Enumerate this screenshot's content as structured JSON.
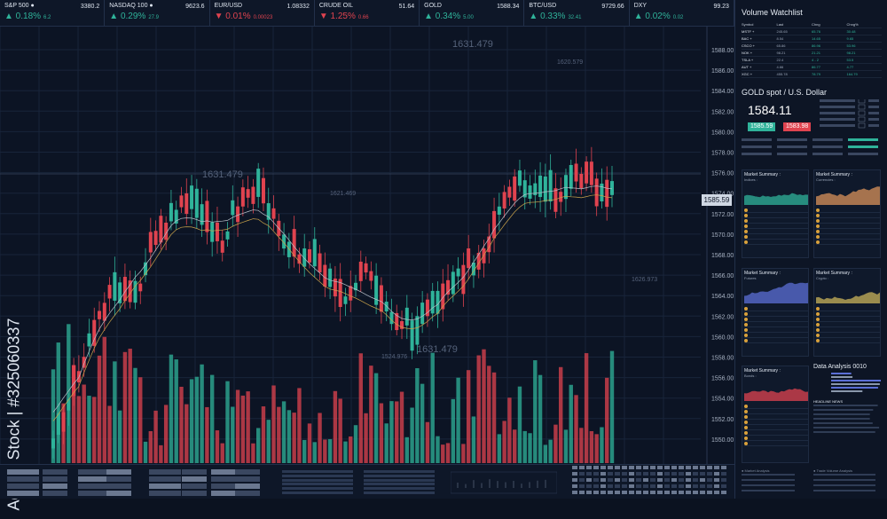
{
  "ticker": [
    {
      "name": "S&P 500 ●",
      "price": "3380.2",
      "change": "0.18%",
      "delta": "6.2",
      "dir": "up"
    },
    {
      "name": "NASDAQ 100 ●",
      "price": "9623.6",
      "change": "0.29%",
      "delta": "27.9",
      "dir": "up"
    },
    {
      "name": "EUR/USD",
      "price": "1.08332",
      "change": "0.01%",
      "delta": "0.00023",
      "dir": "dn"
    },
    {
      "name": "CRUDE OIL",
      "price": "51.64",
      "change": "1.25%",
      "delta": "0.66",
      "dir": "dn"
    },
    {
      "name": "GOLD",
      "price": "1588.34",
      "change": "0.34%",
      "delta": "5.00",
      "dir": "up"
    },
    {
      "name": "BTC/USD",
      "price": "9729.66",
      "change": "0.33%",
      "delta": "32.41",
      "dir": "up"
    },
    {
      "name": "DXY",
      "price": "99.23",
      "change": "0.02%",
      "delta": "0.02",
      "dir": "up"
    }
  ],
  "chart": {
    "price_tag": "1585.59",
    "y_ticks": [
      "1588.00",
      "1586.00",
      "1584.00",
      "1582.00",
      "1580.00",
      "1578.00",
      "1576.00",
      "1574.00",
      "1572.00",
      "1570.00",
      "1568.00",
      "1566.00",
      "1564.00",
      "1562.00",
      "1560.00",
      "1558.00",
      "1556.00",
      "1554.00",
      "1552.00",
      "1550.00"
    ],
    "ghost_labels": [
      "1631.479",
      "1620.579",
      "1631.479",
      "1621.469",
      "1631.479",
      "1524.976",
      "1626.973"
    ],
    "stock_id": "Adobe Stock | #325060337"
  },
  "colors": {
    "up": "#2fb39a",
    "down": "#e0434f",
    "bg": "#0c1424"
  },
  "watchlist": {
    "title": "Volume Watchlist",
    "headers": [
      "Symbol",
      "Last",
      "Chng",
      "Chng%"
    ],
    "rows": [
      [
        "MSTF +",
        "245.65",
        "65.76",
        "30.48"
      ],
      [
        "BAC +",
        "8.54",
        "14.65",
        "9.65"
      ],
      [
        "CSCO +",
        "65.86",
        "86.96",
        "53.96"
      ],
      [
        "NOK +",
        "98.21",
        "21.21",
        "98.21"
      ],
      [
        "TSLA +",
        "22.4",
        "4 - 2",
        "53.5"
      ],
      [
        "AUT +",
        "4.66",
        "86.77",
        "4.77"
      ],
      [
        "XGC +",
        "455.78",
        "78.79",
        "164.79"
      ]
    ]
  },
  "gold": {
    "title": "GOLD spot / U.S. Dollar",
    "price": "1584.11",
    "bid": "1585.59",
    "ask": "1583.98"
  },
  "summaries": [
    {
      "title": "Market Summary :",
      "sub": "Indices :",
      "color": "#2fb39a"
    },
    {
      "title": "Market Summary :",
      "sub": "Currencies :",
      "color": "#d9925a"
    },
    {
      "title": "Market Summary :",
      "sub": "Futures",
      "color": "#5b6fd6"
    },
    {
      "title": "Market Summary :",
      "sub": "Crypto :",
      "color": "#c9b35a"
    },
    {
      "title": "Market Summary :",
      "sub": "Bonds :",
      "color": "#e0434f"
    }
  ],
  "analysis": {
    "title": "Data Analysis 0010",
    "news": "HEADLINE NEWS",
    "footer_a": "● Market Analysis",
    "footer_b": "● Trade Volume Analysis"
  }
}
